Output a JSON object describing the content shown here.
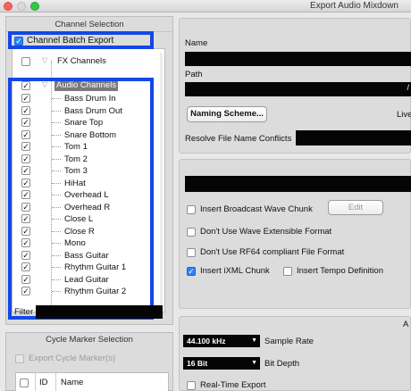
{
  "window": {
    "title": "Export Audio Mixdown"
  },
  "channel_selection": {
    "header": "Channel Selection",
    "batch_export": {
      "label": "Channel Batch Export",
      "checked": true
    },
    "fx_channels": {
      "label": "FX Channels",
      "checked": false
    },
    "audio_channels": {
      "label": "Audio Channels",
      "checked": true,
      "items": [
        "Bass Drum In",
        "Bass Drum Out",
        "Snare Top",
        "Snare Bottom",
        "Tom 1",
        "Tom 2",
        "Tom 3",
        "HiHat",
        "Overhead L",
        "Overhead R",
        "Close L",
        "Close R",
        "Mono",
        "Bass Guitar",
        "Rhythm Guitar 1",
        "Lead Guitar",
        "Rhythm Guitar 2"
      ]
    },
    "filter_label": "Filter"
  },
  "cycle_marker": {
    "header": "Cycle Marker Selection",
    "export_label": "Export Cycle Marker(s)",
    "columns": [
      "ID",
      "Name"
    ]
  },
  "file_location": {
    "name_label": "Name",
    "path_label": "Path",
    "path_slash": "/",
    "naming_scheme_button": "Naming Scheme...",
    "live_label": "Live",
    "resolve_label": "Resolve File Name Conflicts"
  },
  "file_format": {
    "edit_button": "Edit",
    "options": [
      {
        "label": "Insert Broadcast Wave Chunk",
        "checked": false
      },
      {
        "label": "Don't Use Wave Extensible Format",
        "checked": false
      },
      {
        "label": "Don't Use RF64 compliant File Format",
        "checked": false
      },
      {
        "label": "Insert iXML Chunk",
        "checked": true
      },
      {
        "label": "Insert Tempo Definition",
        "checked": false
      }
    ]
  },
  "audio_engine": {
    "header_fragment": "A",
    "sample_rate_value": "44.100 kHz",
    "sample_rate_label": "Sample Rate",
    "bit_depth_value": "16 Bit",
    "bit_depth_label": "Bit Depth",
    "realtime_label": "Real-Time Export"
  },
  "colors": {
    "highlight": "#1447e6",
    "checkbox_checked": "#2a84ff"
  }
}
